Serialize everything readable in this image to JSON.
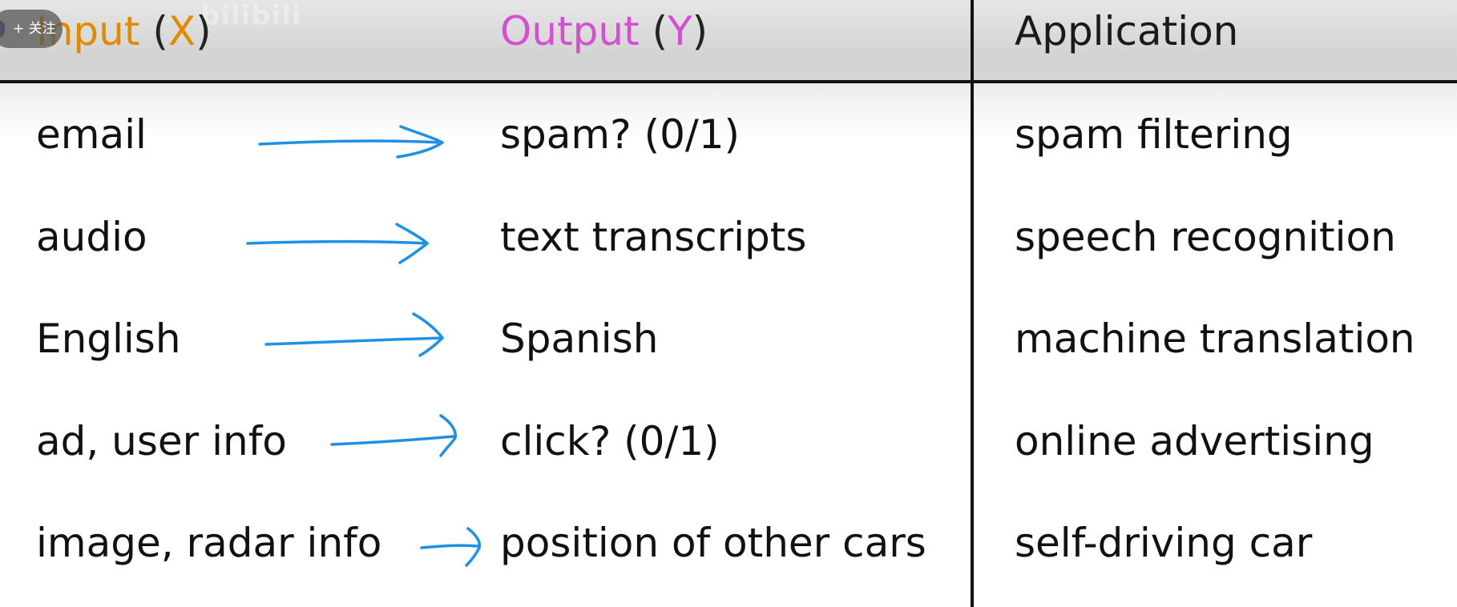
{
  "header": {
    "input_name": "Input",
    "input_var": "X",
    "output_name": "Output",
    "output_var": "Y",
    "application": "Application"
  },
  "rows": [
    {
      "input": "email",
      "output": "spam? (0/1)",
      "application": "spam filtering"
    },
    {
      "input": "audio",
      "output": "text transcripts",
      "application": "speech recognition"
    },
    {
      "input": "English",
      "output": "Spanish",
      "application": "machine translation"
    },
    {
      "input": "ad, user info",
      "output": "click? (0/1)",
      "application": "online advertising"
    },
    {
      "input": "image, radar info",
      "output": "position of other cars",
      "application": "self-driving car"
    }
  ],
  "overlay": {
    "follow_label": "+ 关注"
  },
  "colors": {
    "input_accent": "#e08a00",
    "output_accent": "#d44fd4",
    "arrow": "#1e90e6",
    "rule": "#111111"
  }
}
